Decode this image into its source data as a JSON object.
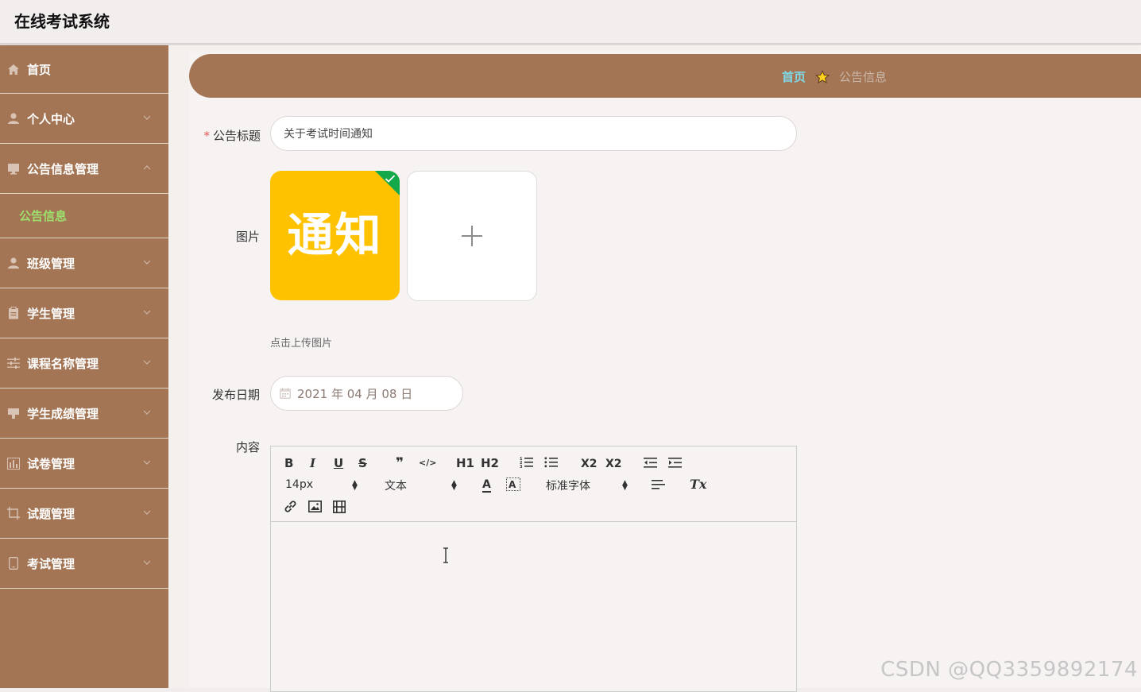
{
  "app": {
    "title": "在线考试系统"
  },
  "sidebar": {
    "items": [
      {
        "label": "首页",
        "icon": "home-icon"
      },
      {
        "label": "个人中心",
        "icon": "user-icon"
      },
      {
        "label": "公告信息管理",
        "icon": "monitor-icon",
        "expanded": true,
        "children": [
          {
            "label": "公告信息"
          }
        ]
      },
      {
        "label": "班级管理",
        "icon": "user-icon"
      },
      {
        "label": "学生管理",
        "icon": "clipboard-icon"
      },
      {
        "label": "课程名称管理",
        "icon": "sliders-icon"
      },
      {
        "label": "学生成绩管理",
        "icon": "monitor-icon"
      },
      {
        "label": "试卷管理",
        "icon": "chart-icon"
      },
      {
        "label": "试题管理",
        "icon": "crop-icon"
      },
      {
        "label": "考试管理",
        "icon": "tablet-icon"
      }
    ]
  },
  "breadcrumb": {
    "home": "首页",
    "current": "公告信息"
  },
  "form": {
    "title_label": "公告标题",
    "title_value": "关于考试时间通知",
    "image_label": "图片",
    "image_text": "通知",
    "upload_tip": "点击上传图片",
    "date_label": "发布日期",
    "date_value": "2021 年 04 月 08 日",
    "content_label": "内容"
  },
  "editor": {
    "font_size": "14px",
    "format": "文本",
    "font_family": "标准字体",
    "buttons": [
      "B",
      "I",
      "U",
      "S",
      "❞",
      "</>",
      "H1",
      "H2",
      "ordered-list",
      "bullet-list",
      "X2",
      "X2",
      "outdent",
      "indent",
      "A",
      "background-color",
      "align",
      "Tx",
      "link",
      "image",
      "video"
    ]
  },
  "colors": {
    "sidebar": "#a37554",
    "accent": "#9ee06e",
    "link": "#7fd8e8",
    "thumb_bg": "#ffc200"
  },
  "watermark": "CSDN @QQ3359892174"
}
